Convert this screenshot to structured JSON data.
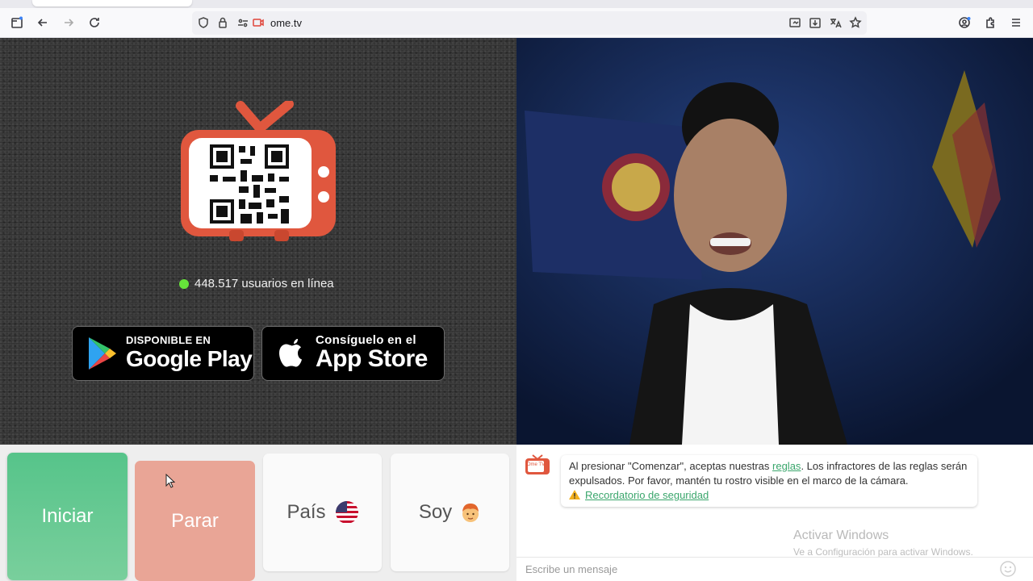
{
  "browser": {
    "url": "ome.tv",
    "icons": [
      "sidebar-icon",
      "back-icon",
      "forward-icon",
      "reload-icon",
      "shield-icon",
      "lock-icon",
      "permissions-icon",
      "camera-icon",
      "screenshot-icon",
      "download-icon",
      "translate-icon",
      "bookmark-star-icon",
      "account-icon",
      "extensions-icon",
      "menu-icon"
    ]
  },
  "left_panel": {
    "online_count": "448.517 usuarios en línea",
    "online_dot_color": "#66e33a",
    "google_play": {
      "small": "DISPONIBLE EN",
      "big": "Google Play"
    },
    "app_store": {
      "small": "Consíguelo en el",
      "big": "App Store"
    }
  },
  "controls": {
    "start": "Iniciar",
    "stop": "Parar",
    "country": "País",
    "gender": "Soy",
    "start_color": "#56c48a",
    "stop_color": "#e9a596"
  },
  "chat": {
    "badge_text": "Ome TV",
    "notice_part1": "Al presionar \"Comenzar\", aceptas nuestras ",
    "notice_link": "reglas",
    "notice_part2": ". Los infractores de las reglas serán expulsados. Por favor, mantén tu rostro visible en el marco de la cámara.",
    "safety_link": "Recordatorio de seguridad",
    "watermark_title": "Activar Windows",
    "watermark_sub": "Ve a Configuración para activar Windows.",
    "input_placeholder": "Escribe un mensaje"
  }
}
